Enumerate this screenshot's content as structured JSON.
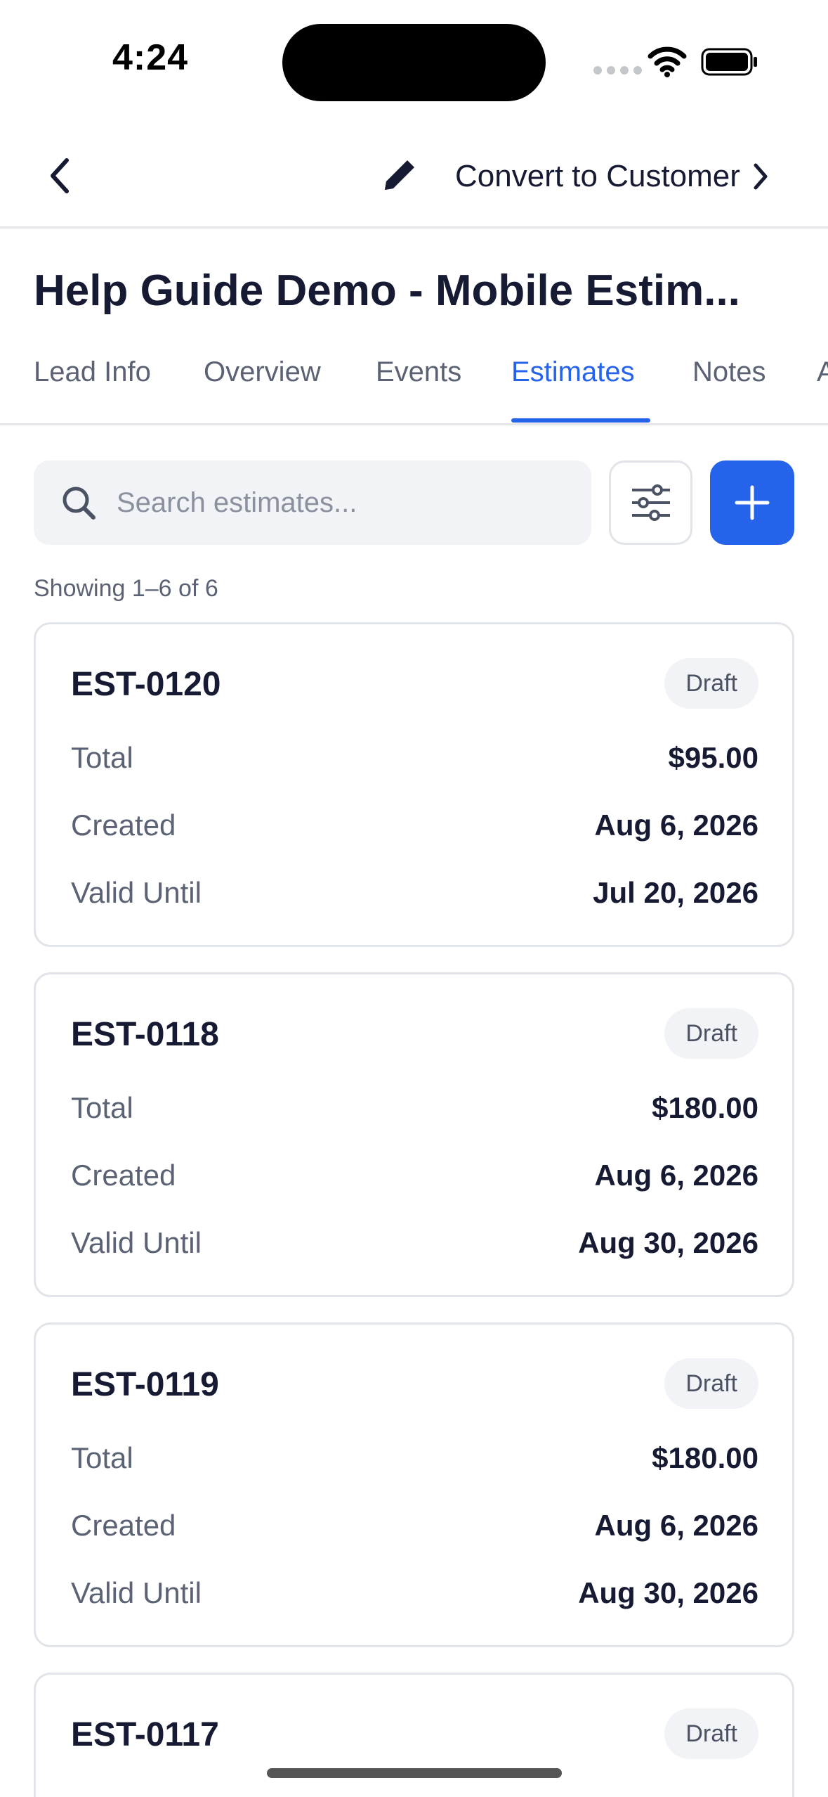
{
  "status_bar": {
    "time": "4:24"
  },
  "nav": {
    "convert_label": "Convert to Customer"
  },
  "lead": {
    "title": "Help Guide Demo - Mobile Estim..."
  },
  "tabs": [
    {
      "label": "Lead Info"
    },
    {
      "label": "Overview"
    },
    {
      "label": "Events"
    },
    {
      "label": "Estimates",
      "active": true
    },
    {
      "label": "Notes"
    },
    {
      "label": "A"
    }
  ],
  "search": {
    "placeholder": "Search estimates...",
    "value": ""
  },
  "list": {
    "showing": "Showing 1–6 of 6"
  },
  "estimates": [
    {
      "number": "EST-0120",
      "status": "Draft",
      "total_label": "Total",
      "total": "$95.00",
      "created_label": "Created",
      "created": "Aug 6, 2026",
      "valid_label": "Valid Until",
      "valid_until": "Jul 20, 2026"
    },
    {
      "number": "EST-0118",
      "status": "Draft",
      "total_label": "Total",
      "total": "$180.00",
      "created_label": "Created",
      "created": "Aug 6, 2026",
      "valid_label": "Valid Until",
      "valid_until": "Aug 30, 2026"
    },
    {
      "number": "EST-0119",
      "status": "Draft",
      "total_label": "Total",
      "total": "$180.00",
      "created_label": "Created",
      "created": "Aug 6, 2026",
      "valid_label": "Valid Until",
      "valid_until": "Aug 30, 2026"
    },
    {
      "number": "EST-0117",
      "status": "Draft"
    }
  ],
  "colors": {
    "accent": "#2563eb",
    "text": "#161b33",
    "muted": "#5b6274",
    "border": "#e1e4e9",
    "badge_bg": "#f1f3f6"
  },
  "icons": [
    "chevron-left-icon",
    "pencil-icon",
    "chevron-right-icon",
    "search-icon",
    "sliders-icon",
    "plus-icon",
    "wifi-icon",
    "battery-icon"
  ]
}
